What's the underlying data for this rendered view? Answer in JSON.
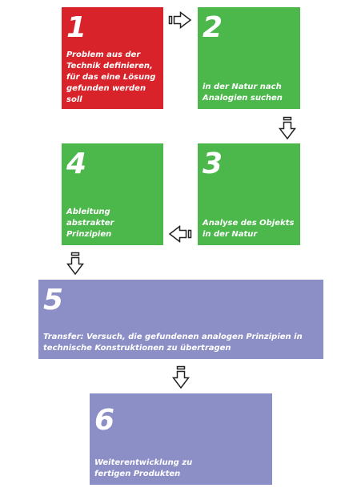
{
  "colors": {
    "red": "#d8232a",
    "green": "#4cb84b",
    "purple": "#8c8ec6",
    "arrow_stroke": "#222222",
    "arrow_fill": "#ffffff"
  },
  "steps": [
    {
      "number": "1",
      "text": "Problem aus der\nTechnik definieren,\nfür das eine Lösung\ngefunden werden\nsoll",
      "color": "red"
    },
    {
      "number": "2",
      "text": "in der Natur nach\nAnalogien suchen",
      "color": "green"
    },
    {
      "number": "3",
      "text": "Analyse des Objekts\nin der Natur",
      "color": "green"
    },
    {
      "number": "4",
      "text": "Ableitung abstrakter\nPrinzipien",
      "color": "green"
    },
    {
      "number": "5",
      "text": "Transfer: Versuch, die gefundenen analogen Prinzipien in\ntechnische Konstruktionen zu übertragen",
      "color": "purple"
    },
    {
      "number": "6",
      "text": "Weiterentwicklung zu\nfertigen Produkten",
      "color": "purple"
    }
  ],
  "arrows": [
    {
      "from": "1",
      "to": "2",
      "direction": "right",
      "icon": "arrow-right-icon"
    },
    {
      "from": "2",
      "to": "3",
      "direction": "down",
      "icon": "arrow-down-icon"
    },
    {
      "from": "3",
      "to": "4",
      "direction": "left",
      "icon": "arrow-left-icon"
    },
    {
      "from": "4",
      "to": "5",
      "direction": "down",
      "icon": "arrow-down-icon"
    },
    {
      "from": "5",
      "to": "6",
      "direction": "down",
      "icon": "arrow-down-icon"
    }
  ]
}
